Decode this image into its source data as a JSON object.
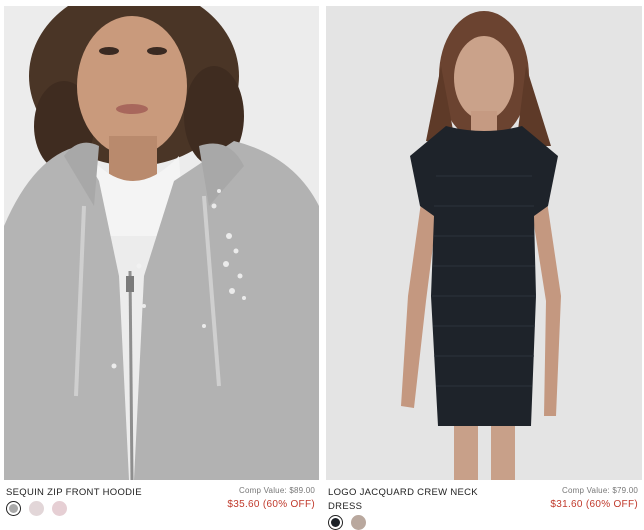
{
  "products": [
    {
      "name": "SEQUIN ZIP FRONT HOODIE",
      "comp_value": "Comp Value: $89.00",
      "sale_price": "$35.60 (60% OFF)",
      "swatch_colors": [
        "#a9a9a9",
        "#e2d6d8",
        "#e6cfd4"
      ],
      "selected_swatch": 0
    },
    {
      "name": "LOGO JACQUARD CREW NECK DRESS",
      "comp_value": "Comp Value: $79.00",
      "sale_price": "$31.60 (60% OFF)",
      "swatch_colors": [
        "#1c2127",
        "#b9a89e"
      ],
      "selected_swatch": 0
    }
  ]
}
